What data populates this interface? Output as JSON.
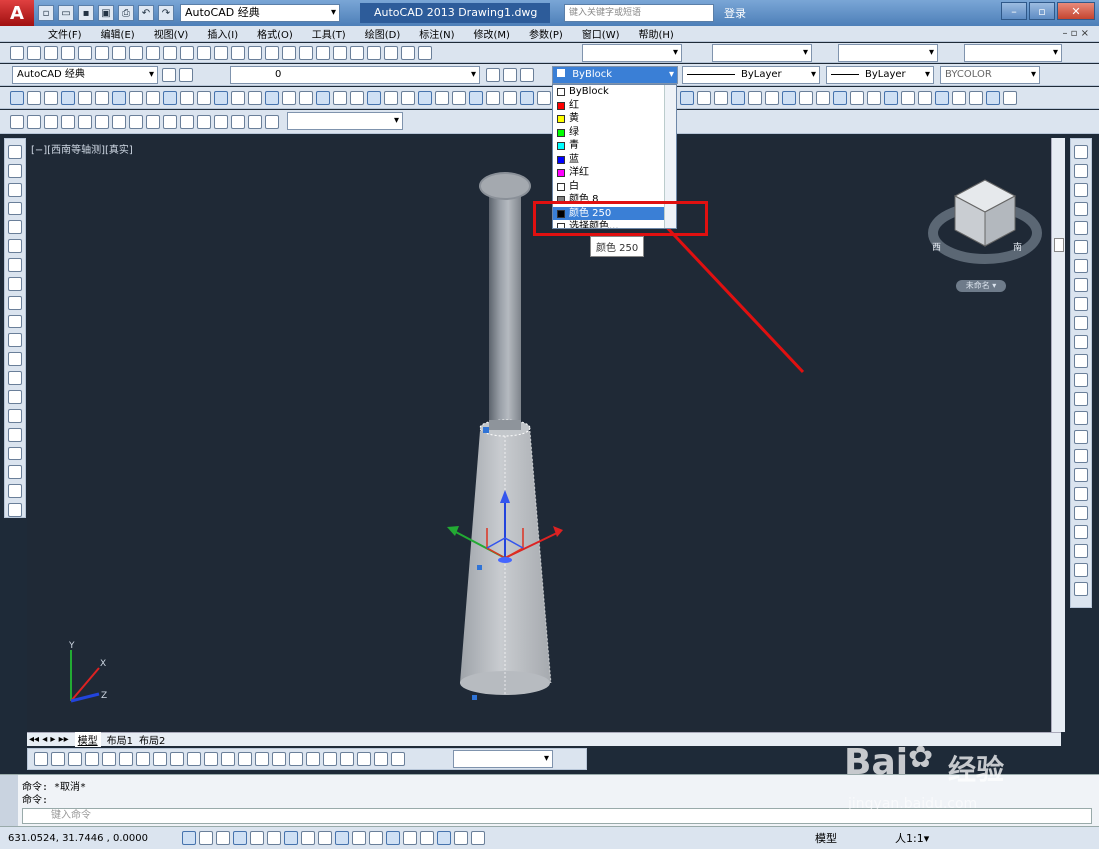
{
  "app": {
    "logo": "A",
    "workspace": "AutoCAD 经典",
    "title": "AutoCAD 2013    Drawing1.dwg",
    "search_placeholder": "键入关键字或短语",
    "login": "登录",
    "brand_color": "#c41818"
  },
  "menu": {
    "items": [
      "文件(F)",
      "编辑(E)",
      "视图(V)",
      "插入(I)",
      "格式(O)",
      "工具(T)",
      "绘图(D)",
      "标注(N)",
      "修改(M)",
      "参数(P)",
      "窗口(W)",
      "帮助(H)"
    ],
    "right": "– ▫ ×"
  },
  "toolbar2": {
    "workspace": "AutoCAD 经典",
    "layer": "0",
    "color": "ByBlock",
    "linetype": "ByLayer",
    "lineweight": "ByLayer",
    "plotstyle": "BYCOLOR"
  },
  "viewport": {
    "label": "[−][西南等轴测][真实]",
    "viewcube_label": "未命名 ▾",
    "ucs_axes": [
      "X",
      "Y",
      "Z"
    ]
  },
  "color_dropdown": {
    "items": [
      {
        "label": "ByBlock",
        "color": "#ffffff"
      },
      {
        "label": "红",
        "color": "#ff0000"
      },
      {
        "label": "黄",
        "color": "#ffff00"
      },
      {
        "label": "绿",
        "color": "#00ff00"
      },
      {
        "label": "青",
        "color": "#00ffff"
      },
      {
        "label": "蓝",
        "color": "#0000ff"
      },
      {
        "label": "洋红",
        "color": "#ff00ff"
      },
      {
        "label": "白",
        "color": "#ffffff"
      },
      {
        "label": "颜色 8",
        "color": "#808080"
      },
      {
        "label": "颜色 250",
        "color": "#000000",
        "selected": true
      },
      {
        "label": "选择颜色...",
        "color": "#ffffff"
      }
    ],
    "tooltip": "颜色 250"
  },
  "tabs": [
    "模型",
    "布局1",
    "布局2"
  ],
  "command": {
    "lines": [
      "命令: *取消*",
      "命令:"
    ],
    "placeholder": "键入命令"
  },
  "status": {
    "coords": "631.0524, 31.7446  , 0.0000",
    "model": "模型",
    "scale": "人1:1▾"
  },
  "watermark": {
    "brand": "Bai",
    "brand2": "经验",
    "url": "jingyan.baidu.com"
  }
}
